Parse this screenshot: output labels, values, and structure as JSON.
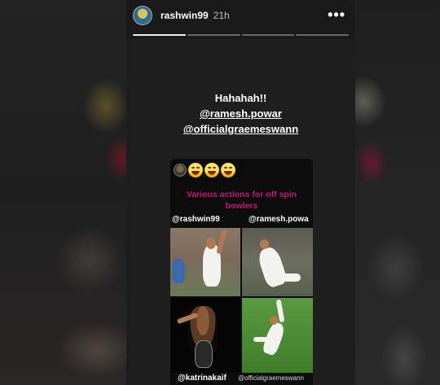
{
  "header": {
    "username": "rashwin99",
    "time": "21h",
    "more_icon": "more-horizontal-icon"
  },
  "progress": {
    "segments": 4,
    "active_index": 0
  },
  "caption": {
    "line1": "Hahahah!!",
    "line2": "@ramesh.powar",
    "line3": "@officialgraemeswann"
  },
  "card": {
    "emojis": [
      "face-with-tears-of-joy",
      "face-with-tears-of-joy",
      "face-with-tears-of-joy"
    ],
    "title_line1": "Various actions for off spin",
    "title_line2": "bowlers",
    "label_top_left": "@rashwin99",
    "label_top_right": "@ramesh.powa",
    "label_bottom_left": "@katrinakaif",
    "label_bottom_right": "@officialgraemeswann",
    "title_color": "#c2197a"
  }
}
